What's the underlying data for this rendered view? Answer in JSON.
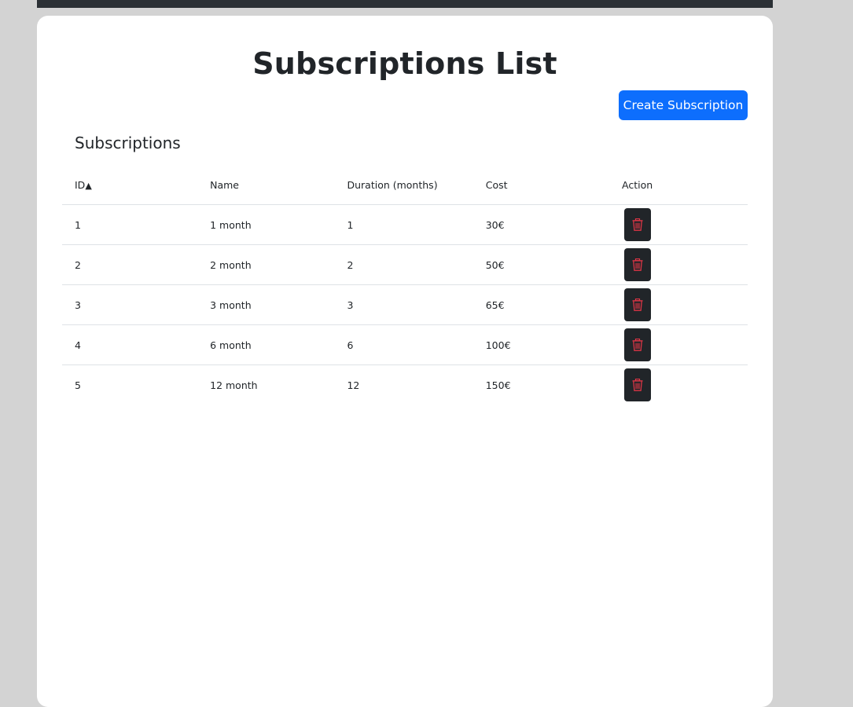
{
  "page": {
    "title": "Subscriptions List",
    "create_button": "Create Subscription",
    "section_title": "Subscriptions"
  },
  "table": {
    "headers": {
      "id": "ID",
      "id_sort_indicator": "▲",
      "name": "Name",
      "duration": "Duration (months)",
      "cost": "Cost",
      "action": "Action"
    },
    "rows": [
      {
        "id": "1",
        "name": "1 month",
        "duration": "1",
        "cost": "30€"
      },
      {
        "id": "2",
        "name": "2 month",
        "duration": "2",
        "cost": "50€"
      },
      {
        "id": "3",
        "name": "3 month",
        "duration": "3",
        "cost": "65€"
      },
      {
        "id": "4",
        "name": "6 month",
        "duration": "6",
        "cost": "100€"
      },
      {
        "id": "5",
        "name": "12 month",
        "duration": "12",
        "cost": "150€"
      }
    ]
  },
  "icons": {
    "delete": "trash-icon"
  },
  "colors": {
    "background": "#d3d3d3",
    "nav_bar": "#2b3035",
    "card": "#ffffff",
    "primary_button": "#0d6efd",
    "delete_button": "#212529",
    "delete_icon": "#dc3545"
  }
}
